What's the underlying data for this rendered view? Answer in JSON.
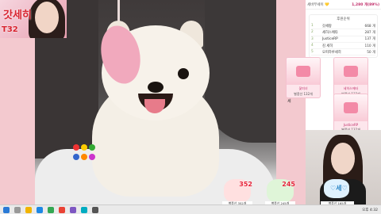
{
  "streamer": {
    "name": "갓세히",
    "number": "T32"
  },
  "panel": {
    "title": "세바무세이 💛",
    "balance": "1,280 개(89%)",
    "ranking_title": "후원순위",
    "ranking": [
      {
        "pos": "1",
        "name": "갓세랑",
        "value": "668 개"
      },
      {
        "pos": "2",
        "name": "세히스에타",
        "value": "287 개"
      },
      {
        "pos": "3",
        "name": "JusticeRP",
        "value": "137 개"
      },
      {
        "pos": "4",
        "name": "김 세히",
        "value": "110 개"
      },
      {
        "pos": "5",
        "name": "오피하루세히",
        "value": "50 개"
      }
    ],
    "donors": [
      {
        "name": "꽃미녀",
        "amount": "별풍선 132개"
      },
      {
        "name": "세히스에타",
        "amount": "별풍선 132개"
      },
      {
        "name": "JusticeRP",
        "amount": "별풍선 132개"
      }
    ],
    "search_letter": "세"
  },
  "overlays": [
    {
      "number": "352",
      "label": "별풍선 352개",
      "color": "#e03b3b"
    },
    {
      "number": "245",
      "label": "별풍선 245개",
      "color": "#2f9e3b"
    }
  ],
  "bunny": {
    "text": "♡세♡",
    "label": "별풍선 165개"
  },
  "taskbar": {
    "tray": "오후 4:32"
  },
  "colors": {
    "accent": "#c12e6a",
    "bg": "#f3c9cf"
  }
}
